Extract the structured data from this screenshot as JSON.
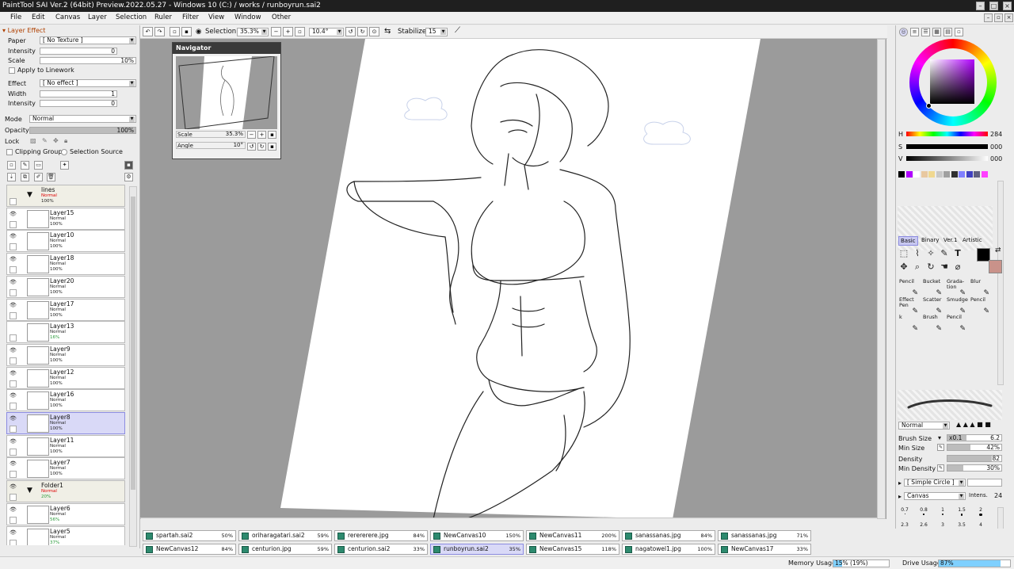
{
  "window": {
    "title": "PaintTool SAI Ver.2 (64bit) Preview.2022.05.27 - Windows 10 (C:) / works / runboyrun.sai2"
  },
  "menu": [
    "File",
    "Edit",
    "Canvas",
    "Layer",
    "Selection",
    "Ruler",
    "Filter",
    "View",
    "Window",
    "Other"
  ],
  "layer_effect": {
    "header": "Layer Effect",
    "paper_label": "Paper",
    "paper_value": "[ No Texture ]",
    "intensity_label": "Intensity",
    "intensity_value": "0",
    "scale_label": "Scale",
    "scale_value": "10%",
    "apply_linework": "Apply to Linework",
    "effect_label": "Effect",
    "effect_value": "[ No effect ]",
    "width_label": "Width",
    "width_value": "1",
    "intensity2_label": "Intensity",
    "intensity2_value": "0",
    "mode_label": "Mode",
    "mode_value": "Normal",
    "opacity_label": "Opacity",
    "opacity_value": "100%",
    "lock_label": "Lock",
    "clipping_group": "Clipping Group",
    "selection_source": "Selection Source"
  },
  "layers": [
    {
      "name": "lines",
      "mode": "Normal",
      "opacity": "100%",
      "folder": true,
      "visible": false
    },
    {
      "name": "Layer15",
      "mode": "Normal",
      "opacity": "100%",
      "visible": true
    },
    {
      "name": "Layer10",
      "mode": "Normal",
      "opacity": "100%",
      "visible": true
    },
    {
      "name": "Layer18",
      "mode": "Normal",
      "opacity": "100%",
      "visible": true
    },
    {
      "name": "Layer20",
      "mode": "Normal",
      "opacity": "100%",
      "visible": true
    },
    {
      "name": "Layer17",
      "mode": "Normal",
      "opacity": "100%",
      "visible": true
    },
    {
      "name": "Layer13",
      "mode": "Normal",
      "opacity": "16%",
      "visible": false
    },
    {
      "name": "Layer9",
      "mode": "Normal",
      "opacity": "100%",
      "visible": true
    },
    {
      "name": "Layer12",
      "mode": "Normal",
      "opacity": "100%",
      "visible": true
    },
    {
      "name": "Layer16",
      "mode": "Normal",
      "opacity": "100%",
      "visible": true
    },
    {
      "name": "Layer8",
      "mode": "Normal",
      "opacity": "100%",
      "visible": true,
      "selected": true
    },
    {
      "name": "Layer11",
      "mode": "Normal",
      "opacity": "100%",
      "visible": true
    },
    {
      "name": "Layer7",
      "mode": "Normal",
      "opacity": "100%",
      "visible": true
    },
    {
      "name": "Folder1",
      "mode": "Normal",
      "opacity": "20%",
      "folder": true,
      "visible": true
    },
    {
      "name": "Layer6",
      "mode": "Normal",
      "opacity": "56%",
      "visible": true
    },
    {
      "name": "Layer5",
      "mode": "Normal",
      "opacity": "37%",
      "visible": true
    }
  ],
  "toolbar": {
    "selection_label": "Selection",
    "zoom": "35.3%",
    "angle": "10.4°",
    "stabilizer_label": "Stabilizer",
    "stabilizer_value": "15"
  },
  "navigator": {
    "title": "Navigator",
    "scale_label": "Scale",
    "scale_value": "35.3%",
    "angle_label": "Angle",
    "angle_value": "10°"
  },
  "color": {
    "h_label": "H",
    "h_value": "284",
    "s_label": "S",
    "s_value": "000",
    "v_label": "V",
    "v_value": "000",
    "primary": "#000000",
    "secondary": "#c9928a"
  },
  "swatches": [
    "#000000",
    "#b000ff",
    "#ffffff",
    "#e8c8a0",
    "#f0d890",
    "#c8c8c8",
    "#a0a0a0",
    "#303030",
    "#8080ff",
    "#4040c0",
    "#606080",
    "#ff40ff"
  ],
  "tool_tabs": [
    "Basic",
    "Binary",
    "Ver.1",
    "Artistic"
  ],
  "brushes": [
    {
      "line1": "Pencil",
      "line2": ""
    },
    {
      "line1": "Bucket",
      "line2": ""
    },
    {
      "line1": "Grada-",
      "line2": "tion"
    },
    {
      "line1": "Blur",
      "line2": ""
    },
    {
      "line1": "Effect",
      "line2": "Pen"
    },
    {
      "line1": "Scatter",
      "line2": ""
    },
    {
      "line1": "Smudge",
      "line2": ""
    },
    {
      "line1": "Pencil",
      "line2": ""
    },
    {
      "line1": "k",
      "line2": ""
    },
    {
      "line1": "Brush",
      "line2": ""
    },
    {
      "line1": "Pencil",
      "line2": ""
    }
  ],
  "brush_settings": {
    "mode": "Normal",
    "brush_size_label": "Brush Size",
    "brush_size_mult": "x0.1",
    "brush_size_value": "6.2",
    "min_size_label": "Min Size",
    "min_size_value": "42%",
    "density_label": "Density",
    "density_value": "82",
    "min_density_label": "Min Density",
    "min_density_value": "30%",
    "shape": "[ Simple Circle ]",
    "texture": "Canvas",
    "intens_label": "Intens.",
    "intens_value": "24"
  },
  "dot_sizes": [
    "0.7",
    "0.8",
    "1",
    "1.5",
    "2",
    "2.3",
    "2.6",
    "3",
    "3.5",
    "4"
  ],
  "file_tabs": [
    {
      "name": "spartah.sai2",
      "pct": "50%"
    },
    {
      "name": "oriharagatari.sai2",
      "pct": "59%"
    },
    {
      "name": "rerererere.jpg",
      "pct": "84%"
    },
    {
      "name": "NewCanvas10",
      "pct": "150%"
    },
    {
      "name": "NewCanvas11",
      "pct": "200%"
    },
    {
      "name": "sanassanas.jpg",
      "pct": "84%"
    },
    {
      "name": "sanassanas.jpg",
      "pct": "71%"
    },
    {
      "name": "NewCanvas12",
      "pct": "84%"
    },
    {
      "name": "centurion.jpg",
      "pct": "59%"
    },
    {
      "name": "centurion.sai2",
      "pct": "33%"
    },
    {
      "name": "runboyrun.sai2",
      "pct": "35%",
      "active": true
    },
    {
      "name": "NewCanvas15",
      "pct": "118%"
    },
    {
      "name": "nagatowel1.jpg",
      "pct": "100%"
    },
    {
      "name": "NewCanvas17",
      "pct": "33%"
    }
  ],
  "status": {
    "memory_label": "Memory Usage",
    "memory_value": "15% (19%)",
    "memory_fraction": 0.15,
    "drive_label": "Drive Usage",
    "drive_value": "87%",
    "drive_fraction": 0.87
  }
}
